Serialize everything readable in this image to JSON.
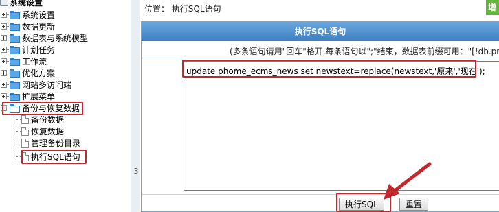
{
  "tree": {
    "root": "系统设置",
    "items": [
      {
        "label": "系统设置",
        "expanded": false
      },
      {
        "label": "数据更新",
        "expanded": false
      },
      {
        "label": "数据表与系统模型",
        "expanded": false
      },
      {
        "label": "计划任务",
        "expanded": false
      },
      {
        "label": "工作流",
        "expanded": false
      },
      {
        "label": "优化方案",
        "expanded": false
      },
      {
        "label": "网站多访问端",
        "expanded": false
      },
      {
        "label": "扩展菜单",
        "expanded": false
      },
      {
        "label": "备份与恢复数据",
        "expanded": true
      }
    ],
    "children": [
      "备份数据",
      "恢复数据",
      "管理备份目录",
      "执行SQL语句"
    ]
  },
  "divider_number": "3",
  "header": {
    "location_label": "位置：",
    "location_text": "执行SQL语句",
    "corner_button": "增"
  },
  "panel": {
    "title": "执行SQL语句",
    "hint": "(多条语句请用\"回车\"格开,每条语句以\";\"结束，数据表前缀可用：\"[!db.pr",
    "sql": "update phome_ecms_news set newstext=replace(newstext,'原来','现在');"
  },
  "buttons": {
    "execute": "执行SQL",
    "reset": "重置"
  },
  "colors": {
    "highlight": "#c0282d",
    "header_blue": "#4f8cc9",
    "accent_green": "#64b53c"
  }
}
